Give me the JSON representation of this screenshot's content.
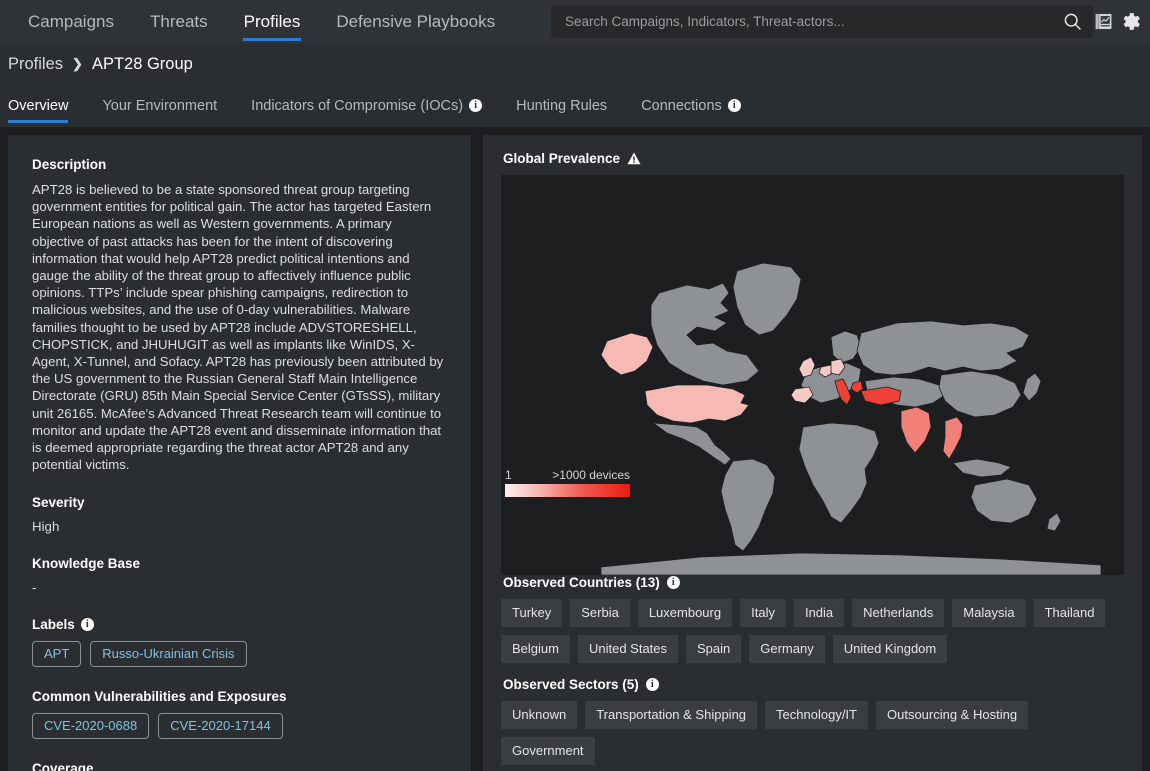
{
  "nav": {
    "items": [
      {
        "label": "Campaigns",
        "active": false
      },
      {
        "label": "Threats",
        "active": false
      },
      {
        "label": "Profiles",
        "active": true
      },
      {
        "label": "Defensive Playbooks",
        "active": false
      }
    ],
    "search_placeholder": "Search Campaigns, Indicators, Threat-actors...",
    "search_value": "",
    "search_icon": "search-icon",
    "report_icon": "report-icon",
    "settings_icon": "gear-icon"
  },
  "breadcrumb": {
    "root": "Profiles",
    "separator": "❯",
    "current": "APT28 Group"
  },
  "tabs": [
    {
      "label": "Overview",
      "info": false,
      "active": true
    },
    {
      "label": "Your Environment",
      "info": false,
      "active": false
    },
    {
      "label": "Indicators of Compromise (IOCs)",
      "info": true,
      "active": false
    },
    {
      "label": "Hunting Rules",
      "info": false,
      "active": false
    },
    {
      "label": "Connections",
      "info": true,
      "active": false
    }
  ],
  "left": {
    "description_heading": "Description",
    "description_text": "APT28 is believed to be a state sponsored threat group targeting government entities for political gain. The actor has targeted Eastern European nations as well as Western governments. A primary objective of past attacks has been for the intent of discovering information that would help APT28 predict political intentions and gauge the ability of the threat group to affectively influence public opinions. TTPs’ include spear phishing campaigns, redirection to malicious websites, and the use of 0-day vulnerabilities. Malware families thought to be used by APT28 include ADVSTORESHELL, CHOPSTICK, and JHUHUGIT as well as implants like WinIDS, X-Agent, X-Tunnel, and Sofacy. APT28 has previously been attributed by the US government to the Russian General Staff Main Intelligence Directorate (GRU) 85th Main Special Service Center (GTsSS), military unit 26165. McAfee's Advanced Threat Research team will continue to monitor and update the APT28 event and disseminate information that is deemed appropriate regarding the threat actor APT28 and any potential victims.",
    "severity_heading": "Severity",
    "severity_value": "High",
    "knowledge_base_heading": "Knowledge Base",
    "knowledge_base_value": "-",
    "labels_heading": "Labels",
    "labels": [
      "APT",
      "Russo-Ukrainian Crisis"
    ],
    "cve_heading": "Common Vulnerabilities and Exposures",
    "cves": [
      "CVE-2020-0688",
      "CVE-2020-17144"
    ],
    "coverage_heading": "Coverage"
  },
  "right": {
    "map_heading": "Global Prevalence",
    "map_warning_icon": "warning-triangle-icon",
    "legend_min": "1",
    "legend_max": ">1000 devices",
    "countries_heading": "Observed Countries (13)",
    "countries": [
      "Turkey",
      "Serbia",
      "Luxembourg",
      "Italy",
      "India",
      "Netherlands",
      "Malaysia",
      "Thailand",
      "Belgium",
      "United States",
      "Spain",
      "Germany",
      "United Kingdom"
    ],
    "sectors_heading": "Observed Sectors (5)",
    "sectors": [
      "Unknown",
      "Transportation & Shipping",
      "Technology/IT",
      "Outsourcing & Hosting",
      "Government"
    ]
  },
  "colors": {
    "accent_blue": "#2a7fd4",
    "link_blue": "#7fc1e3",
    "panel_bg": "#2b2e31",
    "page_bg": "#1c1e20",
    "map_land": "#8f9295",
    "map_high": "#e81d12",
    "map_mid": "#f08078",
    "map_low": "#f8c6c2"
  }
}
